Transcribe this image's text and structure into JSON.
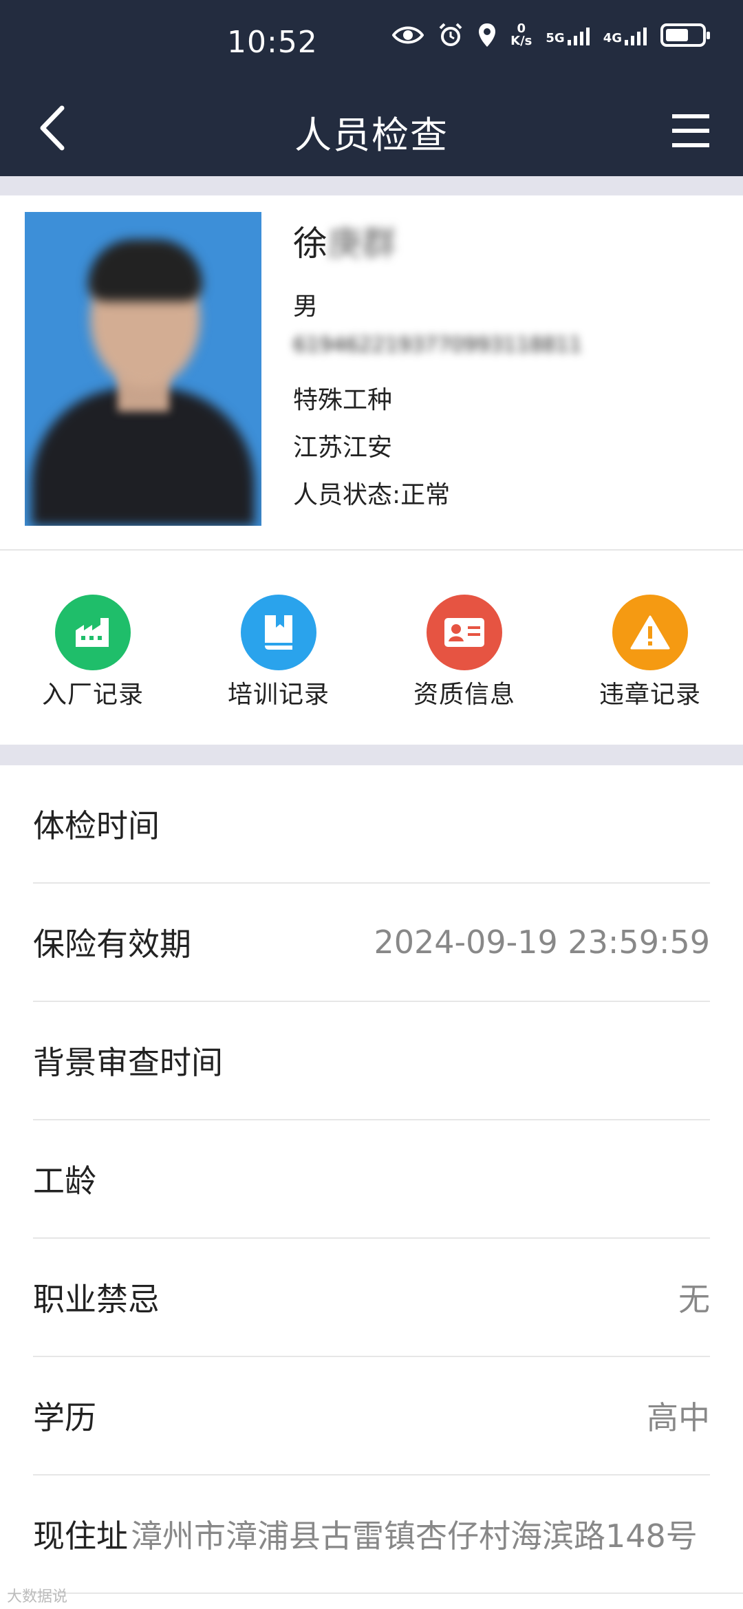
{
  "status_bar": {
    "time": "10:52",
    "speed_value": "0",
    "speed_unit": "K/s",
    "net1": "5G",
    "net2": "4G"
  },
  "navbar": {
    "title": "人员检查"
  },
  "profile": {
    "name": "徐",
    "name_blurred": "庚群",
    "gender": "男",
    "id_blurred": "6194622193770993118811",
    "job_type": "特殊工种",
    "company": "江苏江安",
    "status": "人员状态:正常"
  },
  "actions": [
    {
      "label": "入厂记录",
      "icon": "factory-icon",
      "color": "#1fbe6a"
    },
    {
      "label": "培训记录",
      "icon": "book-icon",
      "color": "#2aa3ec"
    },
    {
      "label": "资质信息",
      "icon": "id-card-icon",
      "color": "#e65442"
    },
    {
      "label": "违章记录",
      "icon": "warning-icon",
      "color": "#f59a12"
    }
  ],
  "details": [
    {
      "label": "体检时间",
      "value": ""
    },
    {
      "label": "保险有效期",
      "value": "2024-09-19 23:59:59"
    },
    {
      "label": "背景审查时间",
      "value": ""
    },
    {
      "label": "工龄",
      "value": ""
    },
    {
      "label": "职业禁忌",
      "value": "无"
    },
    {
      "label": "学历",
      "value": "高中"
    },
    {
      "label": "现住址",
      "value": "漳州市漳浦县古雷镇杏仔村海滨路148号"
    }
  ],
  "watermark": "大数据说"
}
